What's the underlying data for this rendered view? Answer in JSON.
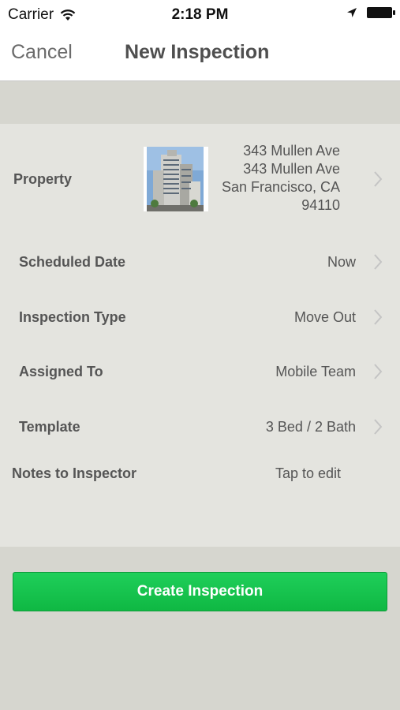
{
  "status": {
    "carrier": "Carrier",
    "time": "2:18 PM"
  },
  "nav": {
    "cancel": "Cancel",
    "title": "New Inspection"
  },
  "property": {
    "label": "Property",
    "address_lines": [
      "343 Mullen Ave",
      "343 Mullen Ave",
      "San Francisco, CA",
      "94110"
    ]
  },
  "rows": [
    {
      "label": "Scheduled Date",
      "value": "Now"
    },
    {
      "label": "Inspection Type",
      "value": "Move Out"
    },
    {
      "label": "Assigned To",
      "value": "Mobile Team"
    },
    {
      "label": "Template",
      "value": "3 Bed / 2 Bath"
    }
  ],
  "notes": {
    "label": "Notes to Inspector",
    "value": "Tap to edit"
  },
  "button": {
    "label": "Create Inspection"
  },
  "colors": {
    "button": "#16c14c",
    "background": "#d6d6cf",
    "card": "#e4e4df"
  }
}
